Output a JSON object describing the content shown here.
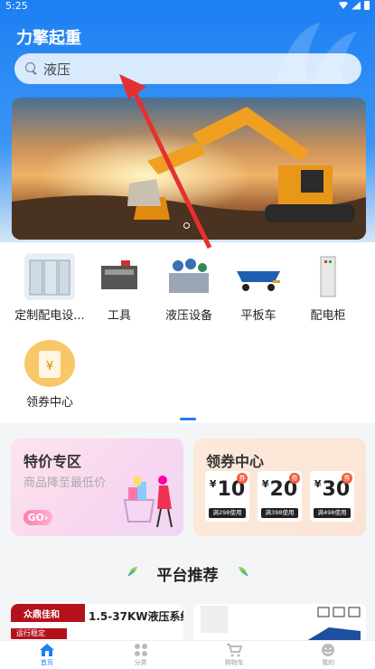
{
  "status": {
    "time": "5:25"
  },
  "app": {
    "title": "力擎起重"
  },
  "search": {
    "text": "液压"
  },
  "categories": [
    {
      "label": "定制配电设..."
    },
    {
      "label": "工具"
    },
    {
      "label": "液压设备"
    },
    {
      "label": "平板车"
    },
    {
      "label": "配电柜"
    },
    {
      "label": "领券中心"
    }
  ],
  "promo": {
    "left": {
      "title": "特价专区",
      "subtitle": "商品降至最低价",
      "go": "GO"
    },
    "right": {
      "title": "领券中心",
      "coupons": [
        {
          "currency": "¥",
          "value": "10",
          "tag": "券",
          "condition": "满298使用"
        },
        {
          "currency": "¥",
          "value": "20",
          "tag": "券",
          "condition": "满398使用"
        },
        {
          "currency": "¥",
          "value": "30",
          "tag": "券",
          "condition": "满498使用"
        }
      ]
    }
  },
  "section": {
    "title": "平台推荐"
  },
  "products": [
    {
      "brand": "众鼎佳和",
      "brand_sub": "运行稳定",
      "name": "1.5-37KW液压系统"
    }
  ],
  "tabs": [
    {
      "label": "首页",
      "icon": "home-icon",
      "active": true
    },
    {
      "label": "分类",
      "icon": "category-icon",
      "active": false
    },
    {
      "label": "购物车",
      "icon": "cart-icon",
      "active": false
    },
    {
      "label": "我的",
      "icon": "profile-icon",
      "active": false
    }
  ],
  "colors": {
    "brand": "#1c7ff2",
    "coupon_tag": "#f25b3a",
    "brand_red": "#b3121b"
  }
}
